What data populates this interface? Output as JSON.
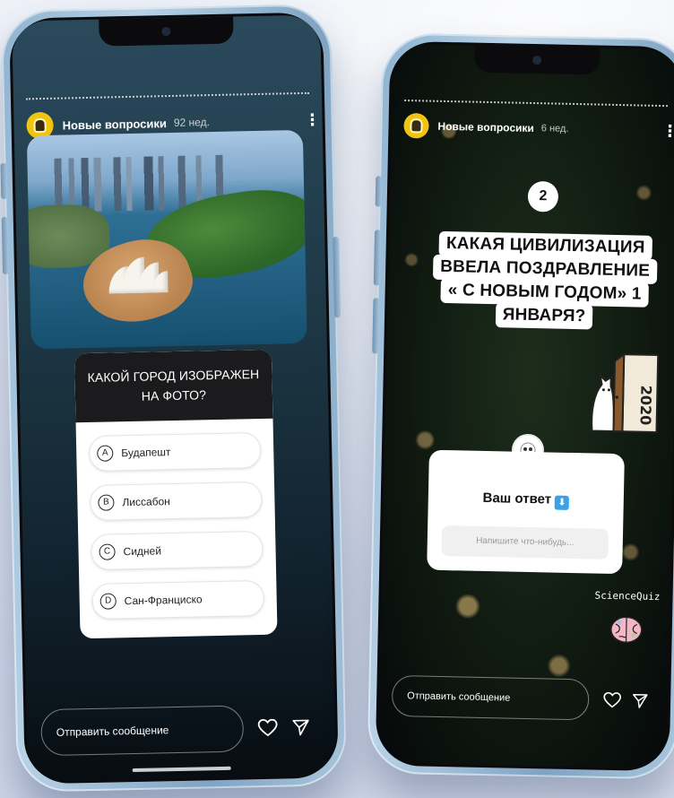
{
  "left_story": {
    "account": "Новые вопросики",
    "time": "92 нед.",
    "image_alt": "Sydney Opera House aerial photo",
    "quiz": {
      "question": "КАКОЙ ГОРОД ИЗОБРАЖЕН НА ФОТО?",
      "options": [
        {
          "letter": "A",
          "label": "Будапешт"
        },
        {
          "letter": "B",
          "label": "Лиссабон"
        },
        {
          "letter": "C",
          "label": "Сидней"
        },
        {
          "letter": "D",
          "label": "Сан-Франциско"
        }
      ]
    },
    "reply_placeholder": "Отправить сообщение"
  },
  "right_story": {
    "account": "Новые вопросики",
    "time": "6 нед.",
    "question_number": "2",
    "question_lines": [
      "КАКАЯ ЦИВИЛИЗАЦИЯ",
      "ВВЕЛА ПОЗДРАВЛЕНИЕ",
      "« С НОВЫМ ГОДОМ» 1",
      "ЯНВАРЯ?"
    ],
    "sticker_text": "2020",
    "answer_box": {
      "title": "Ваш ответ",
      "badge_icon": "down-arrow-icon",
      "placeholder": "Напишите что-нибудь..."
    },
    "brand": "ScienceQuiz",
    "reply_placeholder": "Отправить сообщение"
  },
  "colors": {
    "avatar_bg": "#f1c40f",
    "badge_blue": "#3aa0e8",
    "phone_frame": "#8fb3d0"
  }
}
